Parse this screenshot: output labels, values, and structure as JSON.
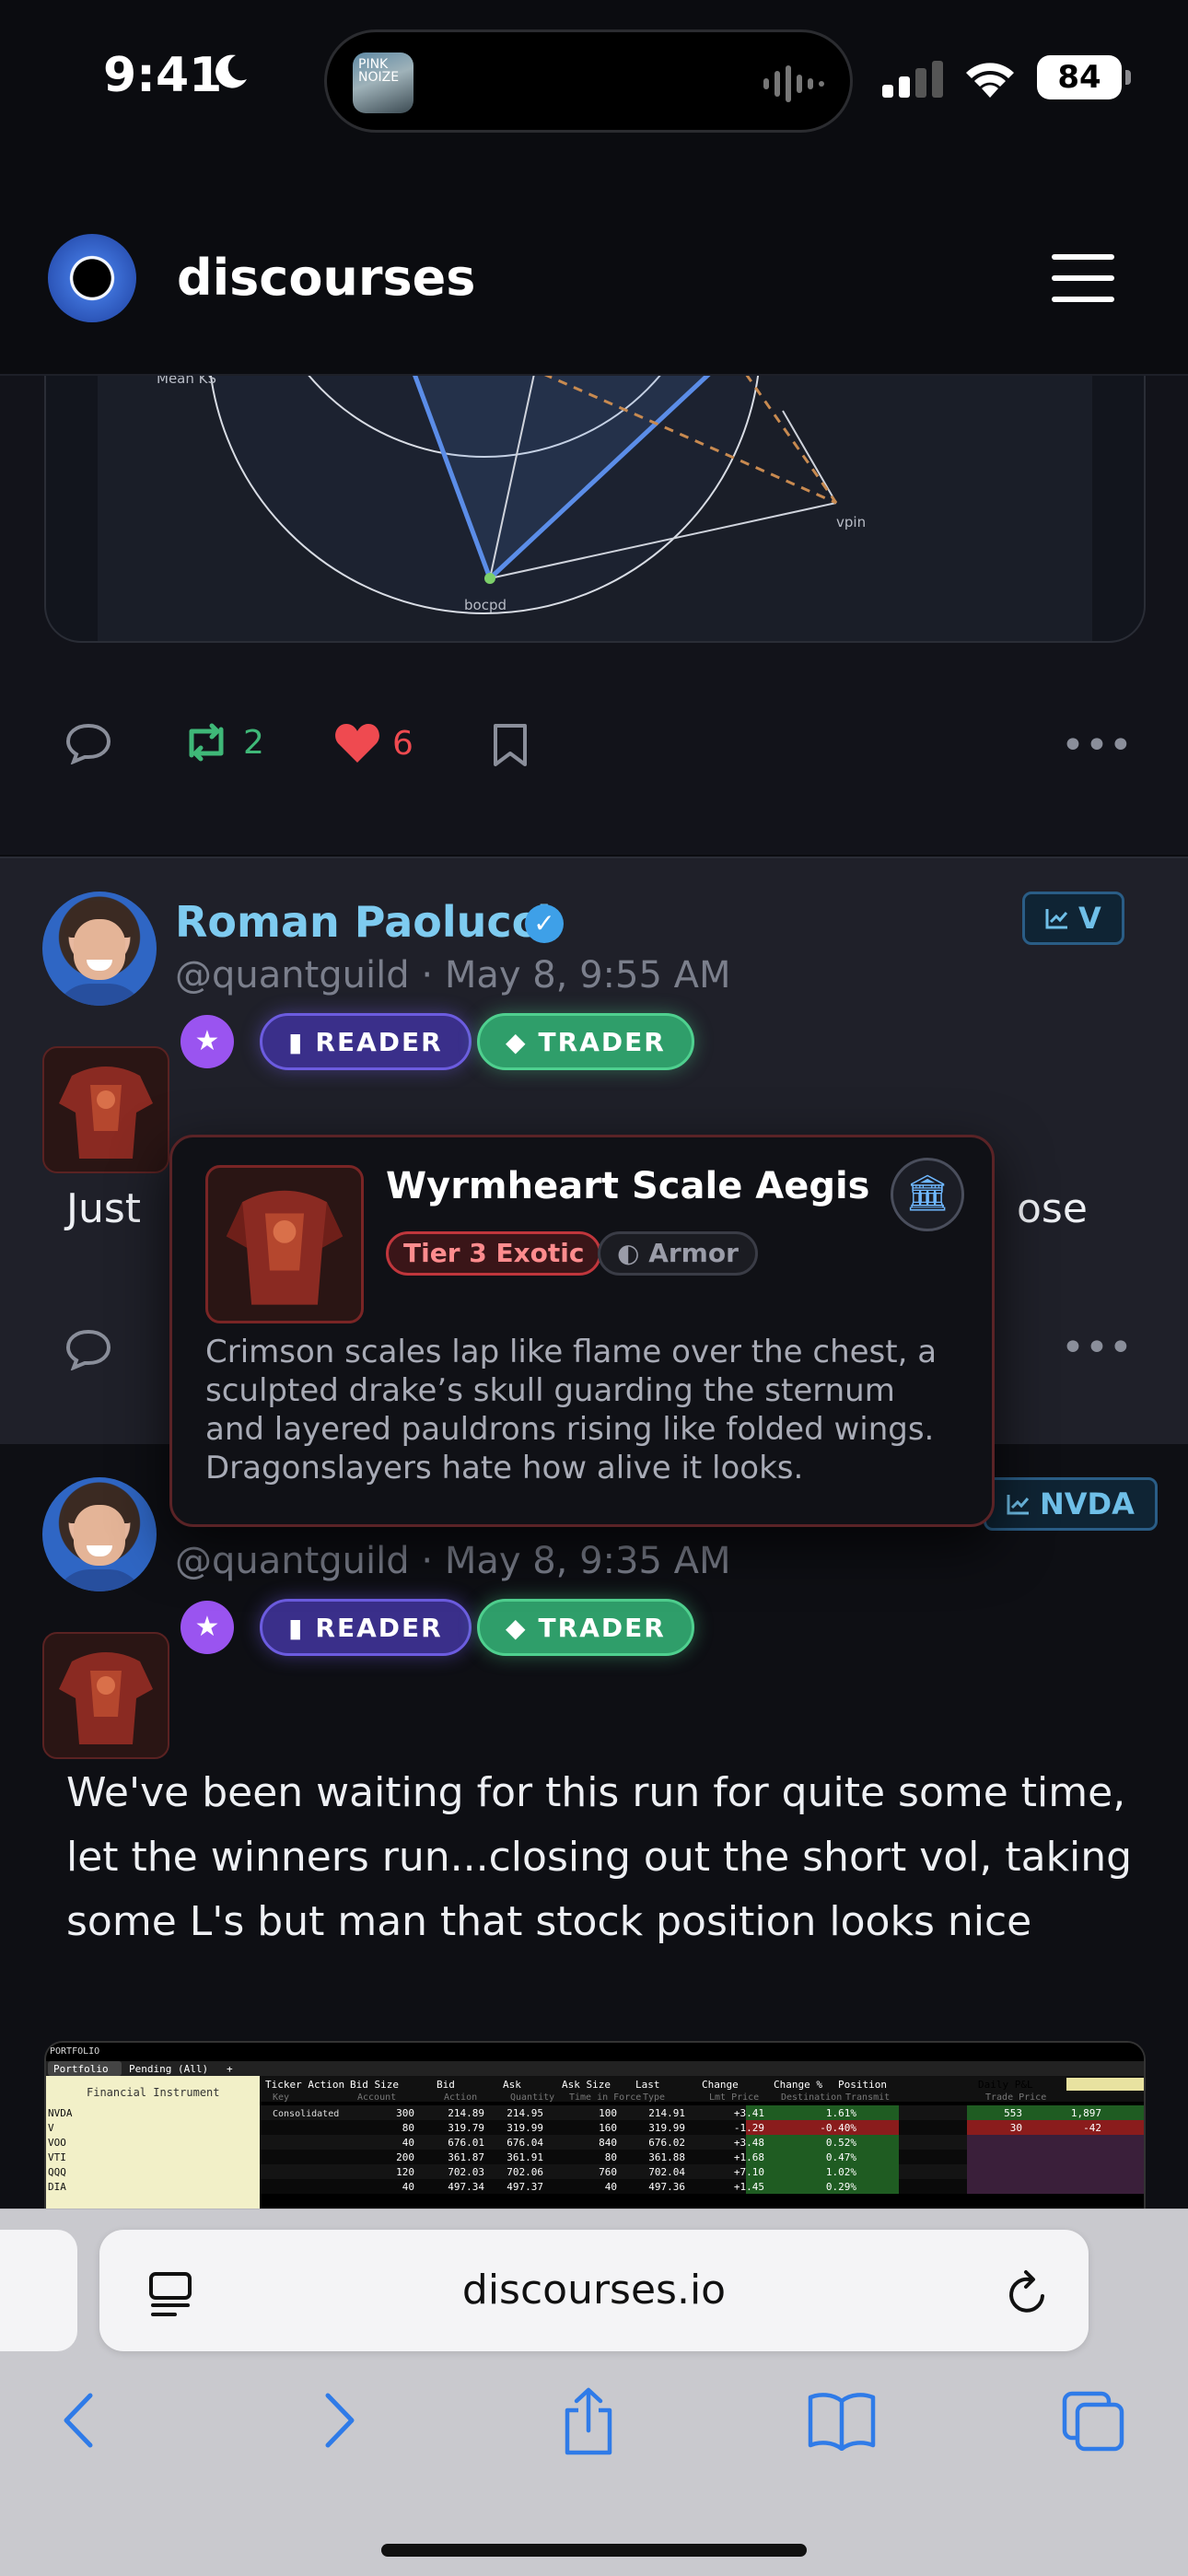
{
  "status_bar": {
    "time": "9:41",
    "battery": "84",
    "island_art_text": "PINK NOIZE"
  },
  "app": {
    "brand": "discourses"
  },
  "post1": {
    "chart_labels": [
      "Mean KS",
      "vpin",
      "bocpd"
    ],
    "retweets": "2",
    "likes": "6"
  },
  "post2": {
    "name": "Roman Paolucci",
    "handle": "@quantguild",
    "time": "May 8, 9:55 AM",
    "badges": [
      "READER",
      "TRADER"
    ],
    "ticker": "V",
    "text_start": "Just",
    "text_end": "ose"
  },
  "popover": {
    "title": "Wyrmheart Scale Aegis",
    "tier": "Tier 3 Exotic",
    "type": "Armor",
    "description": "Crimson scales lap like flame over the chest, a sculpted drake’s skull guarding the sternum and layered pauldrons rising like folded wings. Dragonslayers hate how alive it looks."
  },
  "post3": {
    "handle": "@quantguild",
    "time": "May 8, 9:35 AM",
    "badges": [
      "READER",
      "TRADER"
    ],
    "ticker": "NVDA",
    "text": "We've been waiting for this run for quite some time, let the winners run...closing out the short vol, taking some L's but man that stock position looks nice"
  },
  "table": {
    "title": "PORTFOLIO",
    "tabs": [
      "Portfolio",
      "Pending (All)",
      "+"
    ],
    "left_header": "Financial Instrument",
    "headers": [
      "Ticker Action",
      "Bid Size",
      "Bid",
      "Ask",
      "Ask Size",
      "Last",
      "Change",
      "Change %",
      "Position",
      "Daily P&L"
    ],
    "subheaders": [
      "Key",
      "Account",
      "Action",
      "Quantity",
      "Time in Force",
      "Type",
      "Lmt Price",
      "Destination",
      "Transmit",
      "Trade Price"
    ],
    "rows": [
      {
        "sym": "NVDA",
        "action": "Consolidated",
        "bidsize": "300",
        "bid": "214.89",
        "ask": "214.95",
        "asksize": "100",
        "last": "214.91",
        "chg": "+3.41",
        "chgpct": "1.61%",
        "pos": "553",
        "pnl": "1,897"
      },
      {
        "sym": "V",
        "action": "",
        "bidsize": "80",
        "bid": "319.79",
        "ask": "319.99",
        "asksize": "160",
        "last": "319.99",
        "chg": "-1.29",
        "chgpct": "-0.40%",
        "pos": "30",
        "pnl": "-42"
      },
      {
        "sym": "VOO",
        "action": "",
        "bidsize": "40",
        "bid": "676.01",
        "ask": "676.04",
        "asksize": "840",
        "last": "676.02",
        "chg": "+3.48",
        "chgpct": "0.52%",
        "pos": "",
        "pnl": ""
      },
      {
        "sym": "VTI",
        "action": "",
        "bidsize": "200",
        "bid": "361.87",
        "ask": "361.91",
        "asksize": "80",
        "last": "361.88",
        "chg": "+1.68",
        "chgpct": "0.47%",
        "pos": "",
        "pnl": ""
      },
      {
        "sym": "QQQ",
        "action": "",
        "bidsize": "120",
        "bid": "702.03",
        "ask": "702.06",
        "asksize": "760",
        "last": "702.04",
        "chg": "+7.10",
        "chgpct": "1.02%",
        "pos": "",
        "pnl": ""
      },
      {
        "sym": "DIA",
        "action": "",
        "bidsize": "40",
        "bid": "497.34",
        "ask": "497.37",
        "asksize": "40",
        "last": "497.36",
        "chg": "+1.45",
        "chgpct": "0.29%",
        "pos": "",
        "pnl": ""
      }
    ]
  },
  "safari": {
    "url": "discourses.io"
  },
  "colors": {
    "accent_blue": "#7ecbf0",
    "like_red": "#ef4a50",
    "retweet_green": "#3fb878",
    "exotic_red": "#c0363c"
  }
}
